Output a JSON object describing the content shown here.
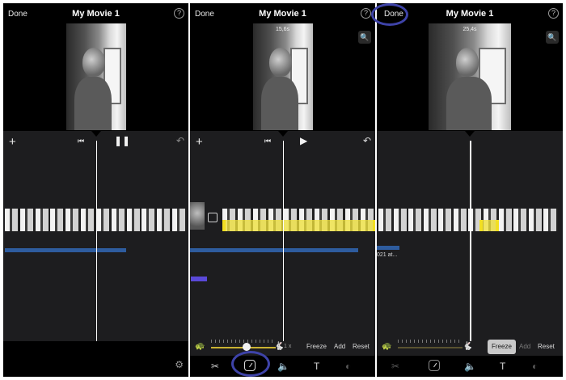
{
  "panels": [
    {
      "done_label": "Done",
      "title": "My Movie 1",
      "help_icon": "?",
      "add_icon": "+",
      "prev_icon": "⏮",
      "playpause_icon": "❚❚",
      "undo_icon": "↶",
      "settings_icon": "⚙"
    },
    {
      "done_label": "Done",
      "title": "My Movie 1",
      "help_icon": "?",
      "time_label": "15,6s",
      "zoom_icon": "🔍",
      "add_icon": "+",
      "prev_icon": "⏮",
      "playpause_icon": "▶",
      "undo_icon": "↶",
      "speed_label": "1 x",
      "freeze_label": "Freeze",
      "add_label": "Add",
      "reset_label": "Reset"
    },
    {
      "done_label": "Done",
      "title": "My Movie 1",
      "help_icon": "?",
      "time_label": "25,4s",
      "zoom_icon": "🔍",
      "audio_label": "021 at...",
      "freeze_label": "Freeze",
      "add_label": "Add",
      "reset_label": "Reset"
    }
  ],
  "icons": {
    "scissors": "✂",
    "volume": "🔈",
    "text": "T",
    "filters": "◐",
    "turtle": "🐢",
    "hare": "🐇"
  },
  "colors": {
    "selection": "#f2df22",
    "annotation": "#3e43a8",
    "audio": "#2e5c9e",
    "voiceover": "#5a49d8"
  },
  "speed_slider_level": 0.55
}
